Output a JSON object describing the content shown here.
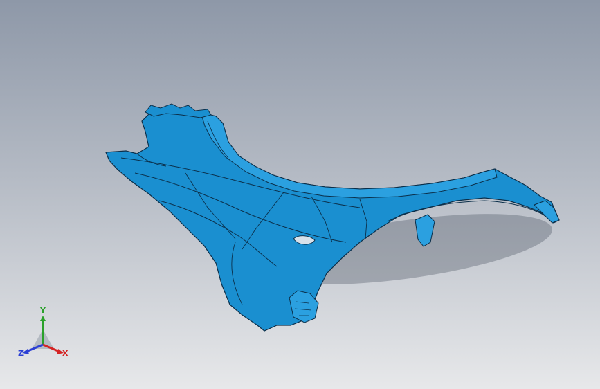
{
  "viewport": {
    "background_top": "#8e98a8",
    "background_bottom": "#e7e8ea",
    "part_color": "#1a8fd0",
    "edge_color": "#0b2f4a"
  },
  "model": {
    "type": "fender-panel",
    "icon": "3d-surface-model"
  },
  "triad": {
    "x_label": "X",
    "y_label": "Y",
    "z_label": "Z",
    "x_color": "#d42424",
    "y_color": "#2aa12a",
    "z_color": "#2b3fd4"
  }
}
